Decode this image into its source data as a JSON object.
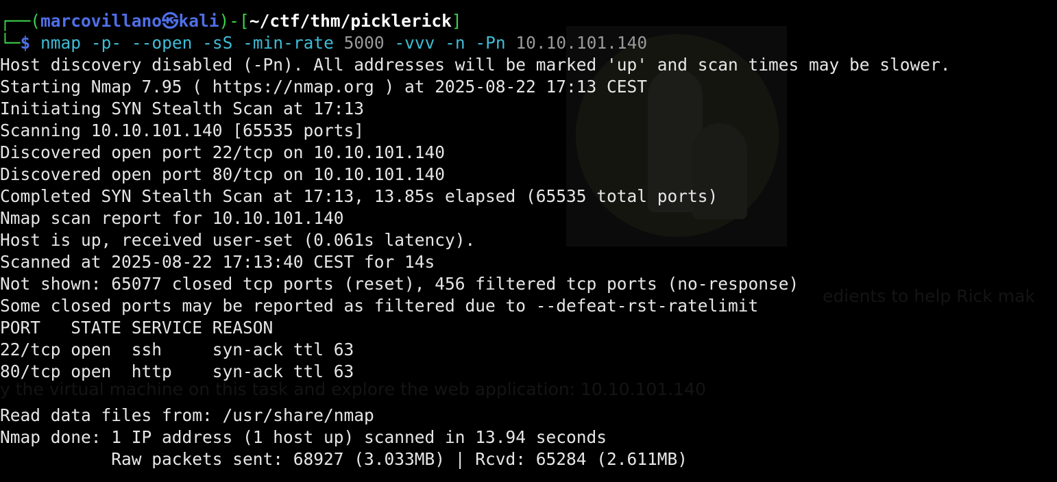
{
  "prompt": {
    "corner_top": "┌──(",
    "user": "marcovillano",
    "at_symbol": "㉿",
    "host": "kali",
    "close_paren": ")-[",
    "path": "~/ctf/thm/picklerick",
    "close_bracket": "]",
    "corner_bottom": "└─",
    "dollar": "$"
  },
  "command": {
    "program": "nmap",
    "args": "-p- --open -sS -min-rate",
    "rate": "5000",
    "flags": "-vvv -n -Pn",
    "target": "10.10.101.140"
  },
  "output_lines": [
    "Host discovery disabled (-Pn). All addresses will be marked 'up' and scan times may be slower.",
    "Starting Nmap 7.95 ( https://nmap.org ) at 2025-08-22 17:13 CEST",
    "Initiating SYN Stealth Scan at 17:13",
    "Scanning 10.10.101.140 [65535 ports]",
    "Discovered open port 22/tcp on 10.10.101.140",
    "Discovered open port 80/tcp on 10.10.101.140",
    "Completed SYN Stealth Scan at 17:13, 13.85s elapsed (65535 total ports)",
    "Nmap scan report for 10.10.101.140",
    "Host is up, received user-set (0.061s latency).",
    "Scanned at 2025-08-22 17:13:40 CEST for 14s",
    "Not shown: 65077 closed tcp ports (reset), 456 filtered tcp ports (no-response)",
    "Some closed ports may be reported as filtered due to --defeat-rst-ratelimit",
    "PORT   STATE SERVICE REASON",
    "22/tcp open  ssh     syn-ack ttl 63",
    "80/tcp open  http    syn-ack ttl 63",
    "",
    "Read data files from: /usr/share/nmap",
    "Nmap done: 1 IP address (1 host up) scanned in 13.94 seconds",
    "           Raw packets sent: 68927 (3.033MB) | Rcvd: 65284 (2.611MB)"
  ],
  "background_text": {
    "line1": "edients to help Rick mak",
    "line2": "y the virtual machine on this task and explore the web application: 10.10.101.140"
  },
  "colors": {
    "background": "#000000",
    "text": "#e6e6e6",
    "prompt_blue": "#4f6fe8",
    "prompt_green": "#3ad14a",
    "command_cyan": "#3dbdd6",
    "arg_grey": "#9a9a9a"
  }
}
